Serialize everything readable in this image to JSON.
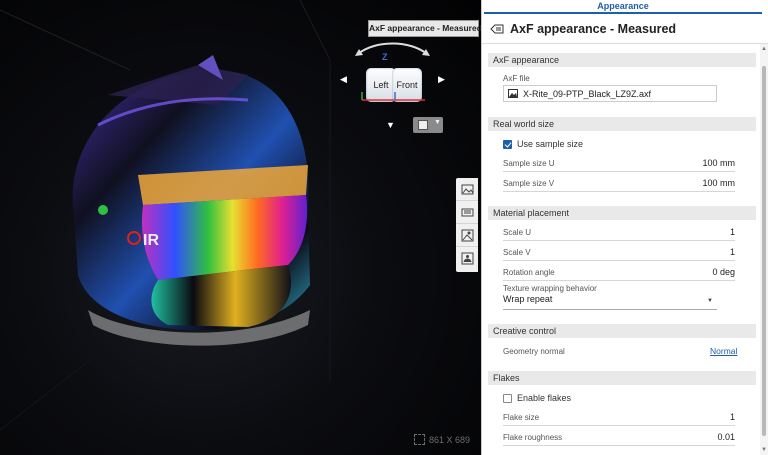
{
  "viewport": {
    "cube_tooltip": "AxF appearance - Measured",
    "cube_left_label": "Left",
    "cube_front_label": "Front",
    "axis_z": "Z",
    "dimensions": "861 X 689"
  },
  "panel": {
    "tab_label": "Appearance",
    "title": "AxF appearance - Measured",
    "sections": {
      "axf": {
        "title": "AxF appearance",
        "file_label": "AxF file",
        "file_name": "X-Rite_09-PTP_Black_LZ9Z.axf"
      },
      "real_world": {
        "title": "Real world size",
        "use_sample_label": "Use sample size",
        "use_sample_checked": true,
        "sample_u_label": "Sample size U",
        "sample_u_value": "100 mm",
        "sample_v_label": "Sample size V",
        "sample_v_value": "100 mm"
      },
      "placement": {
        "title": "Material placement",
        "scale_u_label": "Scale U",
        "scale_u_value": "1",
        "scale_v_label": "Scale V",
        "scale_v_value": "1",
        "rotation_label": "Rotation angle",
        "rotation_value": "0 deg",
        "wrap_label": "Texture wrapping behavior",
        "wrap_value": "Wrap repeat"
      },
      "creative": {
        "title": "Creative control",
        "geometry_label": "Geometry normal",
        "geometry_value": "Normal"
      },
      "flakes": {
        "title": "Flakes",
        "enable_label": "Enable flakes",
        "enable_checked": false,
        "size_label": "Flake size",
        "size_value": "1",
        "roughness_label": "Flake roughness",
        "roughness_value": "0.01"
      }
    }
  },
  "colors": {
    "accent": "#1f5ea8",
    "visor_tint": "#f0a838"
  },
  "icons": [
    "appearance-icon",
    "image-file-icon",
    "checkbox-icon",
    "dropdown-caret-icon",
    "view-cube-icon",
    "fullscreen-icon"
  ]
}
